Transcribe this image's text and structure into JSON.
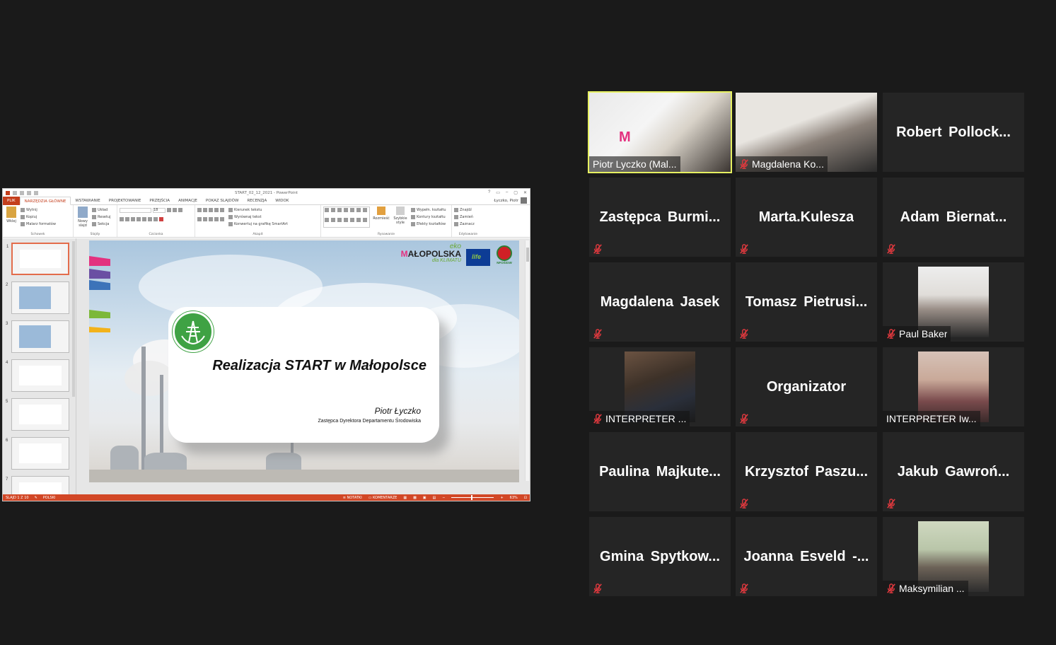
{
  "powerpoint": {
    "doc_title": "START_02_12_2021 - PowerPoint",
    "window_controls": [
      "?",
      "▭",
      "–",
      "▢",
      "✕"
    ],
    "tabs": [
      "PLIK",
      "NARZĘDZIA GŁÓWNE",
      "WSTAWIANIE",
      "PROJEKTOWANIE",
      "PRZEJŚCIA",
      "ANIMACJE",
      "POKAZ SLAJDÓW",
      "RECENZJA",
      "WIDOK"
    ],
    "active_tab_index": 1,
    "user_name": "Łyczko, Piotr",
    "ribbon": {
      "clipboard": {
        "paste": "Wklej",
        "cut": "Wytnij",
        "copy": "Kopiuj",
        "format_painter": "Malarz formatów",
        "group": "Schowek"
      },
      "slides": {
        "new_slide_line1": "Nowy",
        "new_slide_line2": "slajd",
        "layout": "Układ",
        "reset": "Resetuj",
        "section": "Sekcja",
        "group": "Slajdy"
      },
      "font": {
        "size": "18",
        "group": "Czcionka"
      },
      "paragraph": {
        "text_direction": "Kierunek tekstu",
        "align_text": "Wyrównaj tekst",
        "smartart": "Konwertuj na grafikę SmartArt",
        "group": "Akapit"
      },
      "drawing": {
        "arrange": "Rozmieść",
        "quick_styles_line1": "Szybkie",
        "quick_styles_line2": "style",
        "fill": "Wypełn. kształtu",
        "outline": "Kontury kształtu",
        "effects": "Efekty kształtów",
        "group": "Rysowanie"
      },
      "editing": {
        "find": "Znajdź",
        "replace": "Zamień",
        "select": "Zaznacz",
        "group": "Edytowanie"
      }
    },
    "thumb_numbers": [
      "1",
      "2",
      "3",
      "4",
      "5",
      "6",
      "7"
    ],
    "slide": {
      "title": "Realizacja START w Małopolsce",
      "author": "Piotr Łyczko",
      "role": "Zastępca Dyrektora Departamentu Środowiska",
      "logo_eko": "eko",
      "logo_m": "M",
      "logo_name": "AŁOPOLSKA",
      "logo_klimatu": "dla KLIMATU",
      "eu_life": "life",
      "nfos": "NFOŚiGW"
    },
    "status": {
      "slide_count": "SLAJD 1 Z 10",
      "language": "POLSKI",
      "notes": "NOTATKI",
      "comments": "KOMENTARZE",
      "zoom": "63%"
    }
  },
  "participants": [
    {
      "name": "Piotr Lyczko (Mal...",
      "video": true,
      "muted": false,
      "active": true
    },
    {
      "name": "Magdalena Ko...",
      "video": true,
      "muted": true
    },
    {
      "name": "Robert Pollock...",
      "video": false,
      "muted": false
    },
    {
      "name": "Zastępca Burmi...",
      "video": false,
      "muted": true
    },
    {
      "name": "Marta.Kulesza",
      "video": false,
      "muted": true
    },
    {
      "name": "Adam Biernat...",
      "video": false,
      "muted": true
    },
    {
      "name": "Magdalena Jasek",
      "video": false,
      "muted": true
    },
    {
      "name": "Tomasz Pietrusi...",
      "video": false,
      "muted": true
    },
    {
      "name": "Paul Baker",
      "video": true,
      "muted": true
    },
    {
      "name": "INTERPRETER ...",
      "video": true,
      "muted": true
    },
    {
      "name": "Organizator",
      "video": false,
      "muted": true
    },
    {
      "name": "INTERPRETER Iw...",
      "video": true,
      "muted": false
    },
    {
      "name": "Paulina Majkute...",
      "video": false,
      "muted": false
    },
    {
      "name": "Krzysztof Paszu...",
      "video": false,
      "muted": true
    },
    {
      "name": "Jakub Gawroń...",
      "video": false,
      "muted": true
    },
    {
      "name": "Gmina Spytkow...",
      "video": false,
      "muted": true
    },
    {
      "name": "Joanna Esveld -...",
      "video": false,
      "muted": true
    },
    {
      "name": "Maksymilian ...",
      "video": true,
      "muted": true
    }
  ],
  "colors": {
    "active_speaker": "#e6f061",
    "mute_icon": "#e0393e",
    "ppt_accent": "#d24726",
    "tile_bg": "#252525",
    "page_bg": "#1a1a1a"
  }
}
